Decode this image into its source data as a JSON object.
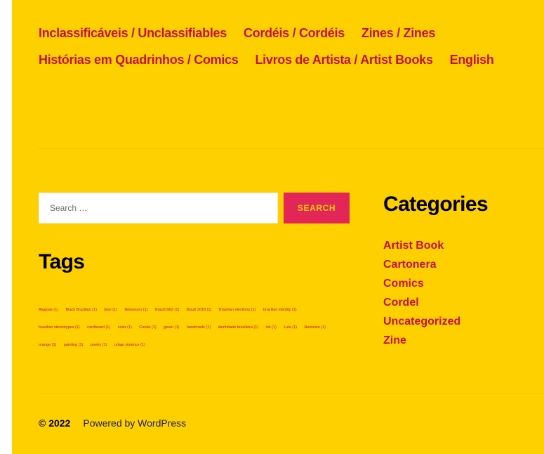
{
  "nav": {
    "row1": [
      "Inclassificáveis / Unclassifiables",
      "Cordéis / Cordéis",
      "Zines / Zines"
    ],
    "row2": [
      "Histórias em Quadrinhos / Comics",
      "Livros de Artista / Artist Books",
      "English"
    ]
  },
  "search": {
    "placeholder": "Search …",
    "button_label": "SEARCH"
  },
  "tags": {
    "title": "Tags",
    "items": [
      "Alagoas (1)",
      "Black Brazilian (1)",
      "blue (1)",
      "Bolsonaro (1)",
      "Brazil1962 (1)",
      "Brazil 2018 (1)",
      "Brazilian elections (1)",
      "brazilian identity (1)",
      "brazilian stereotypes (1)",
      "cardboard (1)",
      "color (1)",
      "Cordel (1)",
      "green (1)",
      "handmade (1)",
      "identidade brasileira (1)",
      "ink (1)",
      "Lula (1)",
      "Nordeste (1)",
      "orange (1)",
      "painting (1)",
      "poetry (1)",
      "urban violence (1)"
    ]
  },
  "categories": {
    "title": "Categories",
    "items": [
      "Artist Book",
      "Cartonera",
      "Comics",
      "Cordel",
      "Uncategorized",
      "Zine"
    ]
  },
  "footer": {
    "copyright": "© 2022",
    "powered": "Powered by WordPress"
  },
  "colors": {
    "background": "#ffd000",
    "link": "#c5102f",
    "button": "#e22658"
  }
}
